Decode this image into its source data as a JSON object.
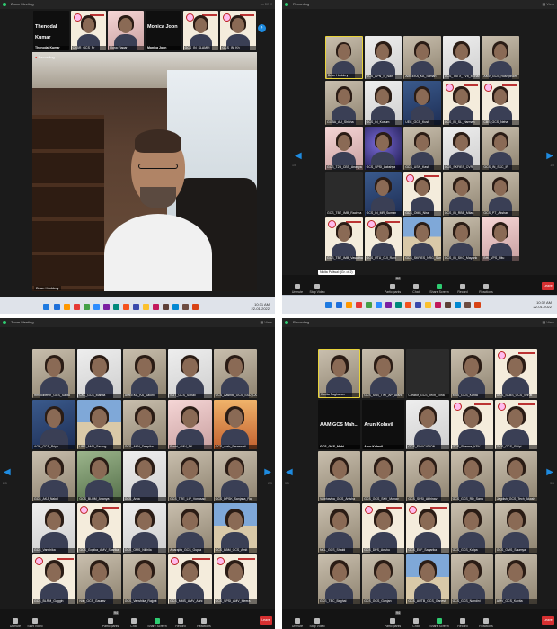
{
  "q1": {
    "window_title": "Zoom Meeting",
    "strip": [
      {
        "label": "Thenodal Kumar",
        "tag": "Thenodal Kumar",
        "kind": "name"
      },
      {
        "label": "CKBR_GCS_Pr",
        "kind": "cert"
      },
      {
        "label": "Rona Fiaqar",
        "kind": "pink"
      },
      {
        "label": "Monica Joon",
        "tag": "Monica Joon",
        "kind": "name"
      },
      {
        "label": "GCS_IN_SLAMPI",
        "kind": "cert"
      },
      {
        "label": "GCS_IN_Kh",
        "kind": "cert"
      }
    ],
    "recording": "Recording",
    "speaker_name": "Brian Hoddery",
    "taskbar_time": "10:31 AM",
    "taskbar_date": "22-01-2022"
  },
  "q2": {
    "window_title": "Zoom Meeting",
    "recording": "Recording",
    "page_left": "1/5",
    "page_right": "1/5",
    "tiles": [
      {
        "n": "Brian Hoddery",
        "bg": "room",
        "spk": true
      },
      {
        "n": "GCS_APN_S_Nair",
        "bg": "white"
      },
      {
        "n": "AMEEKA_KA_Suman",
        "bg": "room"
      },
      {
        "n": "GCS_TBTX_TV5_Mohan",
        "bg": "white"
      },
      {
        "n": "AMV_GCS_Rushpinder",
        "bg": "room"
      },
      {
        "n": "GGBA_AU_Shikha",
        "bg": "room"
      },
      {
        "n": "GCS_IN_Kusum",
        "bg": "white"
      },
      {
        "n": "UEC_GCS_Kush",
        "bg": "blue"
      },
      {
        "n": "GCS_IN_SL_Harman",
        "bg": "cert"
      },
      {
        "n": "CBS_GCS_Neha",
        "bg": "cert"
      },
      {
        "n": "GCS_T2B_CBT_Ananya",
        "bg": "pink"
      },
      {
        "n": "GCS_SPSI_Lakshya",
        "bg": "space"
      },
      {
        "n": "GCS_USN_Kash",
        "bg": "room"
      },
      {
        "n": "GCS_SKFIES_CVR",
        "bg": "white"
      },
      {
        "n": "GCS_IN_SKC_IF",
        "bg": "room"
      },
      {
        "n": "GCS_TBT_IMB_Rachna",
        "bg": "dark"
      },
      {
        "n": "GCS_IN_MR_Suman",
        "bg": "blue"
      },
      {
        "n": "GCS_OMS_Nira",
        "bg": "cert"
      },
      {
        "n": "GCS_IN_RBB_Milan",
        "bg": "room"
      },
      {
        "n": "GCS_PT_Akshar",
        "bg": "room"
      },
      {
        "n": "GCS_TBT_IMB_Vasudha",
        "bg": "cert"
      },
      {
        "n": "GCS_UTU_GJI_Ravi",
        "bg": "cert"
      },
      {
        "n": "GCS_SKFIES_NRG_Sunil",
        "bg": "city"
      },
      {
        "n": "GCS_IN_SKC_Mayank",
        "bg": "room"
      },
      {
        "n": "BHI_VPS_Ritu",
        "bg": "pink"
      }
    ],
    "tooltip": "Nikita Paliwal: (Gr. of 2)",
    "controls": [
      "Unmute",
      "Stop Video",
      "Participants",
      "Chat",
      "Share Screen",
      "Record",
      "Reactions"
    ],
    "participants_count": "94",
    "leave": "Leave",
    "taskbar_time": "10:32 AM",
    "taskbar_date": "22-01-2022"
  },
  "q3": {
    "window_title": "Zoom Meeting",
    "page_left": "2/5",
    "page_right": "2/5",
    "tiles": [
      {
        "n": "mmholbertin_GCS_Sarita",
        "bg": "room"
      },
      {
        "n": "CKL_GCS_Mamta",
        "bg": "white"
      },
      {
        "n": "AMEEKA_KA_Saloni",
        "bg": "room"
      },
      {
        "n": "SGT_GCS_Sonali",
        "bg": "white"
      },
      {
        "n": "GCS_Aashita_GCS_SSD_LAMA",
        "bg": "room"
      },
      {
        "n": "AGK_GCS_Priya",
        "bg": "blue"
      },
      {
        "n": "UBS_AMV_Sarang",
        "bg": "city"
      },
      {
        "n": "GCS_AMV_Deepika",
        "bg": "room"
      },
      {
        "n": "Ruchi_AMV_SK",
        "bg": "pink"
      },
      {
        "n": "GCS_Arsh_Saraswati",
        "bg": "bridge"
      },
      {
        "n": "GCS_AKJ_Nakul",
        "bg": "room"
      },
      {
        "n": "GCS_BLHM_Ananya",
        "bg": "green"
      },
      {
        "n": "GCS_Arna",
        "bg": "white"
      },
      {
        "n": "GCS_TRE_LIP_Vonasad",
        "bg": "room"
      },
      {
        "n": "GCS_DPSK_Sanjana_Raj",
        "bg": "room"
      },
      {
        "n": "GCS_Vanshika",
        "bg": "white"
      },
      {
        "n": "GCS_Gopika_AMV_Sasrika",
        "bg": "cert"
      },
      {
        "n": "GCS_OMS_Nikhila",
        "bg": "white"
      },
      {
        "n": "Aparajita_GCS_Gupta",
        "bg": "room"
      },
      {
        "n": "GCS_BBM_GCS_Amit",
        "bg": "city"
      },
      {
        "n": "GCS_BLRM_Guggin",
        "bg": "cert"
      },
      {
        "n": "Nilu_GCS_Gaurav",
        "bg": "room"
      },
      {
        "n": "GCS_Vanshika_Rajput",
        "bg": "room"
      },
      {
        "n": "GCS_MMS_AMV_Aahi",
        "bg": "cert"
      },
      {
        "n": "GCS_SPSI_AMV_Meera",
        "bg": "cert"
      }
    ],
    "controls": [
      "Unmute",
      "Start Video",
      "Participants",
      "Chat",
      "Share Screen",
      "Record",
      "Reactions"
    ],
    "participants_count": "94",
    "leave": "Leave"
  },
  "q4": {
    "window_title": "Recording",
    "page_left": "3/5",
    "page_right": "3/5",
    "tiles": [
      {
        "n": "Kavita Raghavan",
        "bg": "room",
        "spk": true
      },
      {
        "n": "GCS_SSB_TINI_AP_Akshit",
        "bg": "room"
      },
      {
        "n": "Creator_GCS_Tech_Elina",
        "bg": "dark"
      },
      {
        "n": "MBS_GCS_Kanta",
        "bg": "room"
      },
      {
        "n": "GCS_SKBS_GCS_Shruti",
        "bg": "cert"
      },
      {
        "n": "AAM GCS Mah...",
        "bg": "namebox",
        "label2": "GCS_GCS_Mahi"
      },
      {
        "n": "Arun Kolavil",
        "bg": "namebox",
        "label2": "Arun Kolavil"
      },
      {
        "n": "GCS_EDUCATION",
        "bg": "white"
      },
      {
        "n": "GCS_Sharma_KSV",
        "bg": "cert"
      },
      {
        "n": "GCS_GCS_Shilpi",
        "bg": "cert"
      },
      {
        "n": "Vaibhavika_GCS_Anisha",
        "bg": "room"
      },
      {
        "n": "GCS_GCS_SKV_Manav",
        "bg": "room"
      },
      {
        "n": "GCS_SPSI_Abhinav",
        "bg": "room"
      },
      {
        "n": "GCS_GCS_RD_Sana",
        "bg": "room"
      },
      {
        "n": "Jagdish_GCS_Tech_Akashi",
        "bg": "room"
      },
      {
        "n": "NCL_GCS_Shakti",
        "bg": "room"
      },
      {
        "n": "GCS_DPS_Anshu",
        "bg": "cert"
      },
      {
        "n": "GCS_ELF_Sagarika",
        "bg": "cert"
      },
      {
        "n": "GCS_GCS_Kalpa",
        "bg": "room"
      },
      {
        "n": "GCS_OMS_Saumya",
        "bg": "room"
      },
      {
        "n": "GCS_TBC_Baghal",
        "bg": "room"
      },
      {
        "n": "GCS_GCS_Gunjan",
        "bg": "room"
      },
      {
        "n": "GCS_AUTB_GCS_Ganesh",
        "bg": "city"
      },
      {
        "n": "GCS_GCS_Nandini",
        "bg": "room"
      },
      {
        "n": "AMV_GCS_Kavita",
        "bg": "room"
      }
    ],
    "controls": [
      "Unmute",
      "Stop Video",
      "Participants",
      "Chat",
      "Share Screen",
      "Record",
      "Reactions"
    ],
    "participants_count": "94",
    "leave": "Leave"
  }
}
